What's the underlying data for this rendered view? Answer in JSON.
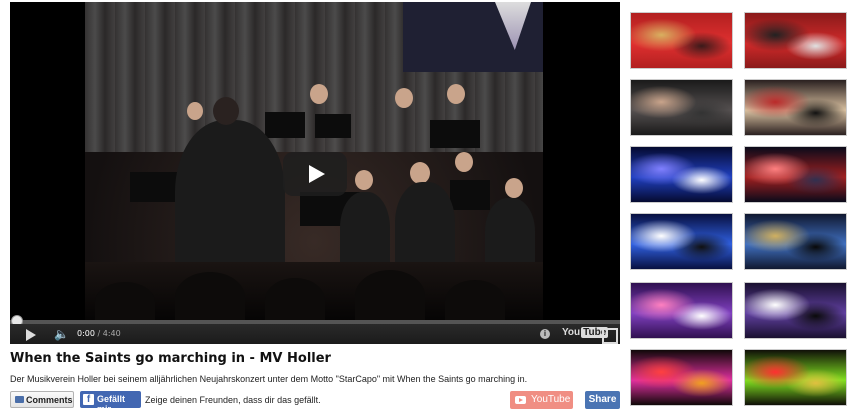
{
  "video": {
    "time_current": "0:00",
    "time_separator": "/",
    "time_duration": "4:40",
    "youtube_logo_you": "You",
    "youtube_logo_tube": "Tube"
  },
  "info": {
    "title": "When the Saints go marching in - MV Holler",
    "description": "Der Musikverein Holler bei seinem alljährlichen Neujahrskonzert unter dem Motto \"StarCapo\" mit When the Saints go marching in."
  },
  "actions": {
    "comments_label": "Comments",
    "facebook_label": "Gefällt mir",
    "facebook_text": "Zeige deinen Freunden, dass dir das gefällt.",
    "youtube_label": "YouTube",
    "share_label": "Share"
  },
  "icons": {
    "play": "play-icon",
    "volume": "volume-icon",
    "info": "info-icon",
    "fullscreen": "fullscreen-icon",
    "comment": "comment-icon",
    "facebook": "facebook-icon",
    "youtube": "youtube-icon"
  },
  "colors": {
    "facebook_blue": "#4267b2",
    "youtube_button": "#f08e83",
    "share_button": "#4a74b3"
  },
  "playlist": {
    "thumbnails": [
      {
        "name": "thumb-1",
        "palette": [
          "#b22020",
          "#e03030",
          "#d8b060",
          "#3a1a1a"
        ]
      },
      {
        "name": "thumb-2",
        "palette": [
          "#8a1a1a",
          "#d02a2a",
          "#222222",
          "#e0e0e0"
        ]
      },
      {
        "name": "thumb-3",
        "palette": [
          "#1a1a1a",
          "#555050",
          "#c9a48b",
          "#333333"
        ]
      },
      {
        "name": "thumb-4",
        "palette": [
          "#2a2020",
          "#d8c0a0",
          "#bb2a2a",
          "#111111"
        ]
      },
      {
        "name": "thumb-5",
        "palette": [
          "#050a30",
          "#2040c0",
          "#8080ff",
          "#ffffff"
        ]
      },
      {
        "name": "thumb-6",
        "palette": [
          "#0a0a1a",
          "#a02020",
          "#ff8080",
          "#303050"
        ]
      },
      {
        "name": "thumb-7",
        "palette": [
          "#081040",
          "#3060e0",
          "#ffffff",
          "#101010"
        ]
      },
      {
        "name": "thumb-8",
        "palette": [
          "#101830",
          "#4070c0",
          "#d0b060",
          "#080808"
        ]
      },
      {
        "name": "thumb-9",
        "palette": [
          "#301050",
          "#8040c0",
          "#ff80c0",
          "#ffffff"
        ]
      },
      {
        "name": "thumb-10",
        "palette": [
          "#1a1030",
          "#6040a0",
          "#ffffff",
          "#0a0a0a"
        ]
      },
      {
        "name": "thumb-11",
        "palette": [
          "#100808",
          "#e030a0",
          "#ff4040",
          "#f0a020"
        ]
      },
      {
        "name": "thumb-12",
        "palette": [
          "#101008",
          "#80e020",
          "#ff3030",
          "#e0c040"
        ]
      }
    ]
  }
}
